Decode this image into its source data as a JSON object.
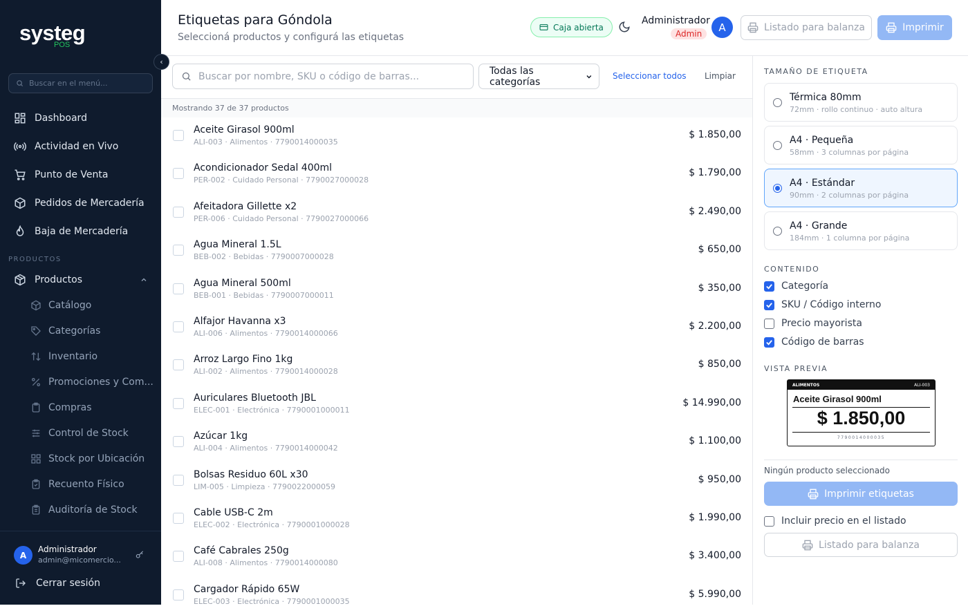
{
  "brand": {
    "word": "systeg",
    "sub": "POS"
  },
  "sidebar": {
    "search_placeholder": "Buscar en el menú...",
    "nav": [
      {
        "label": "Dashboard",
        "icon": "dashboard-icon"
      },
      {
        "label": "Actividad en Vivo",
        "icon": "broadcast-icon"
      },
      {
        "label": "Punto de Venta",
        "icon": "cart-icon"
      },
      {
        "label": "Pedidos de Mercadería",
        "icon": "box-icon"
      },
      {
        "label": "Baja de Mercadería",
        "icon": "flame-icon"
      }
    ],
    "section": "PRODUCTOS",
    "group": {
      "label": "Productos",
      "icon": "package-icon"
    },
    "sub": [
      {
        "label": "Catálogo",
        "icon": "cube-icon"
      },
      {
        "label": "Categorías",
        "icon": "tag-icon"
      },
      {
        "label": "Inventario",
        "icon": "sort-icon"
      },
      {
        "label": "Promociones y Com...",
        "icon": "percent-icon"
      },
      {
        "label": "Compras",
        "icon": "clipboard-icon"
      },
      {
        "label": "Control de Stock",
        "icon": "sliders-icon"
      },
      {
        "label": "Stock por Ubicación",
        "icon": "grid-icon"
      },
      {
        "label": "Recuento Físico",
        "icon": "clipboard-check-icon"
      },
      {
        "label": "Auditoría de Stock",
        "icon": "clipboard-list-icon"
      }
    ],
    "user": {
      "initial": "A",
      "name": "Administrador",
      "email": "admin@micomercio..."
    },
    "logout": "Cerrar sesión"
  },
  "header": {
    "title": "Etiquetas para Góndola",
    "subtitle": "Seleccioná productos y configurá las etiquetas",
    "caja": "Caja abierta",
    "user_name": "Administrador",
    "role": "Admin",
    "avatar_initial": "A",
    "btn_listado": "Listado para balanza",
    "btn_imprimir": "Imprimir"
  },
  "toolbar": {
    "search_placeholder": "Buscar por nombre, SKU o código de barras...",
    "category": "Todas las categorías",
    "select_all": "Seleccionar todos",
    "clear": "Limpiar",
    "count": "Mostrando 37 de 37 productos"
  },
  "products": [
    {
      "name": "Aceite Girasol 900ml",
      "meta": "ALI-003 · Alimentos · 7790014000035",
      "price": "$ 1.850,00"
    },
    {
      "name": "Acondicionador Sedal 400ml",
      "meta": "PER-002 · Cuidado Personal · 7790027000028",
      "price": "$ 1.790,00"
    },
    {
      "name": "Afeitadora Gillette x2",
      "meta": "PER-006 · Cuidado Personal · 7790027000066",
      "price": "$ 2.490,00"
    },
    {
      "name": "Agua Mineral 1.5L",
      "meta": "BEB-002 · Bebidas · 7790007000028",
      "price": "$ 650,00"
    },
    {
      "name": "Agua Mineral 500ml",
      "meta": "BEB-001 · Bebidas · 7790007000011",
      "price": "$ 350,00"
    },
    {
      "name": "Alfajor Havanna x3",
      "meta": "ALI-006 · Alimentos · 7790014000066",
      "price": "$ 2.200,00"
    },
    {
      "name": "Arroz Largo Fino 1kg",
      "meta": "ALI-002 · Alimentos · 7790014000028",
      "price": "$ 850,00"
    },
    {
      "name": "Auriculares Bluetooth JBL",
      "meta": "ELEC-001 · Electrónica · 7790001000011",
      "price": "$ 14.990,00"
    },
    {
      "name": "Azúcar 1kg",
      "meta": "ALI-004 · Alimentos · 7790014000042",
      "price": "$ 1.100,00"
    },
    {
      "name": "Bolsas Residuo 60L x30",
      "meta": "LIM-005 · Limpieza · 7790022000059",
      "price": "$ 950,00"
    },
    {
      "name": "Cable USB-C 2m",
      "meta": "ELEC-002 · Electrónica · 7790001000028",
      "price": "$ 1.990,00"
    },
    {
      "name": "Café Cabrales 250g",
      "meta": "ALI-008 · Alimentos · 7790014000080",
      "price": "$ 3.400,00"
    },
    {
      "name": "Cargador Rápido 65W",
      "meta": "ELEC-003 · Electrónica · 7790001000035",
      "price": "$ 5.990,00"
    }
  ],
  "panel": {
    "size_label": "TAMAÑO DE ETIQUETA",
    "sizes": [
      {
        "title": "Térmica 80mm",
        "desc": "72mm · rollo continuo · auto altura",
        "selected": false
      },
      {
        "title": "A4 · Pequeña",
        "desc": "58mm · 3 columnas por página",
        "selected": false
      },
      {
        "title": "A4 · Estándar",
        "desc": "90mm · 2 columnas por página",
        "selected": true
      },
      {
        "title": "A4 · Grande",
        "desc": "184mm · 1 columna por página",
        "selected": false
      }
    ],
    "content_label": "CONTENIDO",
    "content": [
      {
        "label": "Categoría",
        "checked": true
      },
      {
        "label": "SKU / Código interno",
        "checked": true
      },
      {
        "label": "Precio mayorista",
        "checked": false
      },
      {
        "label": "Código de barras",
        "checked": true
      }
    ],
    "preview_label": "VISTA PREVIA",
    "preview": {
      "category": "ALIMENTOS",
      "sku": "ALI-003",
      "name": "Aceite Girasol 900ml",
      "price": "$ 1.850,00",
      "barcode": "7790014000035"
    },
    "selection": "Ningún producto seleccionado",
    "print_btn": "Imprimir etiquetas",
    "include_price": "Incluir precio en el listado",
    "include_price_checked": false,
    "listado_btn": "Listado para balanza"
  }
}
